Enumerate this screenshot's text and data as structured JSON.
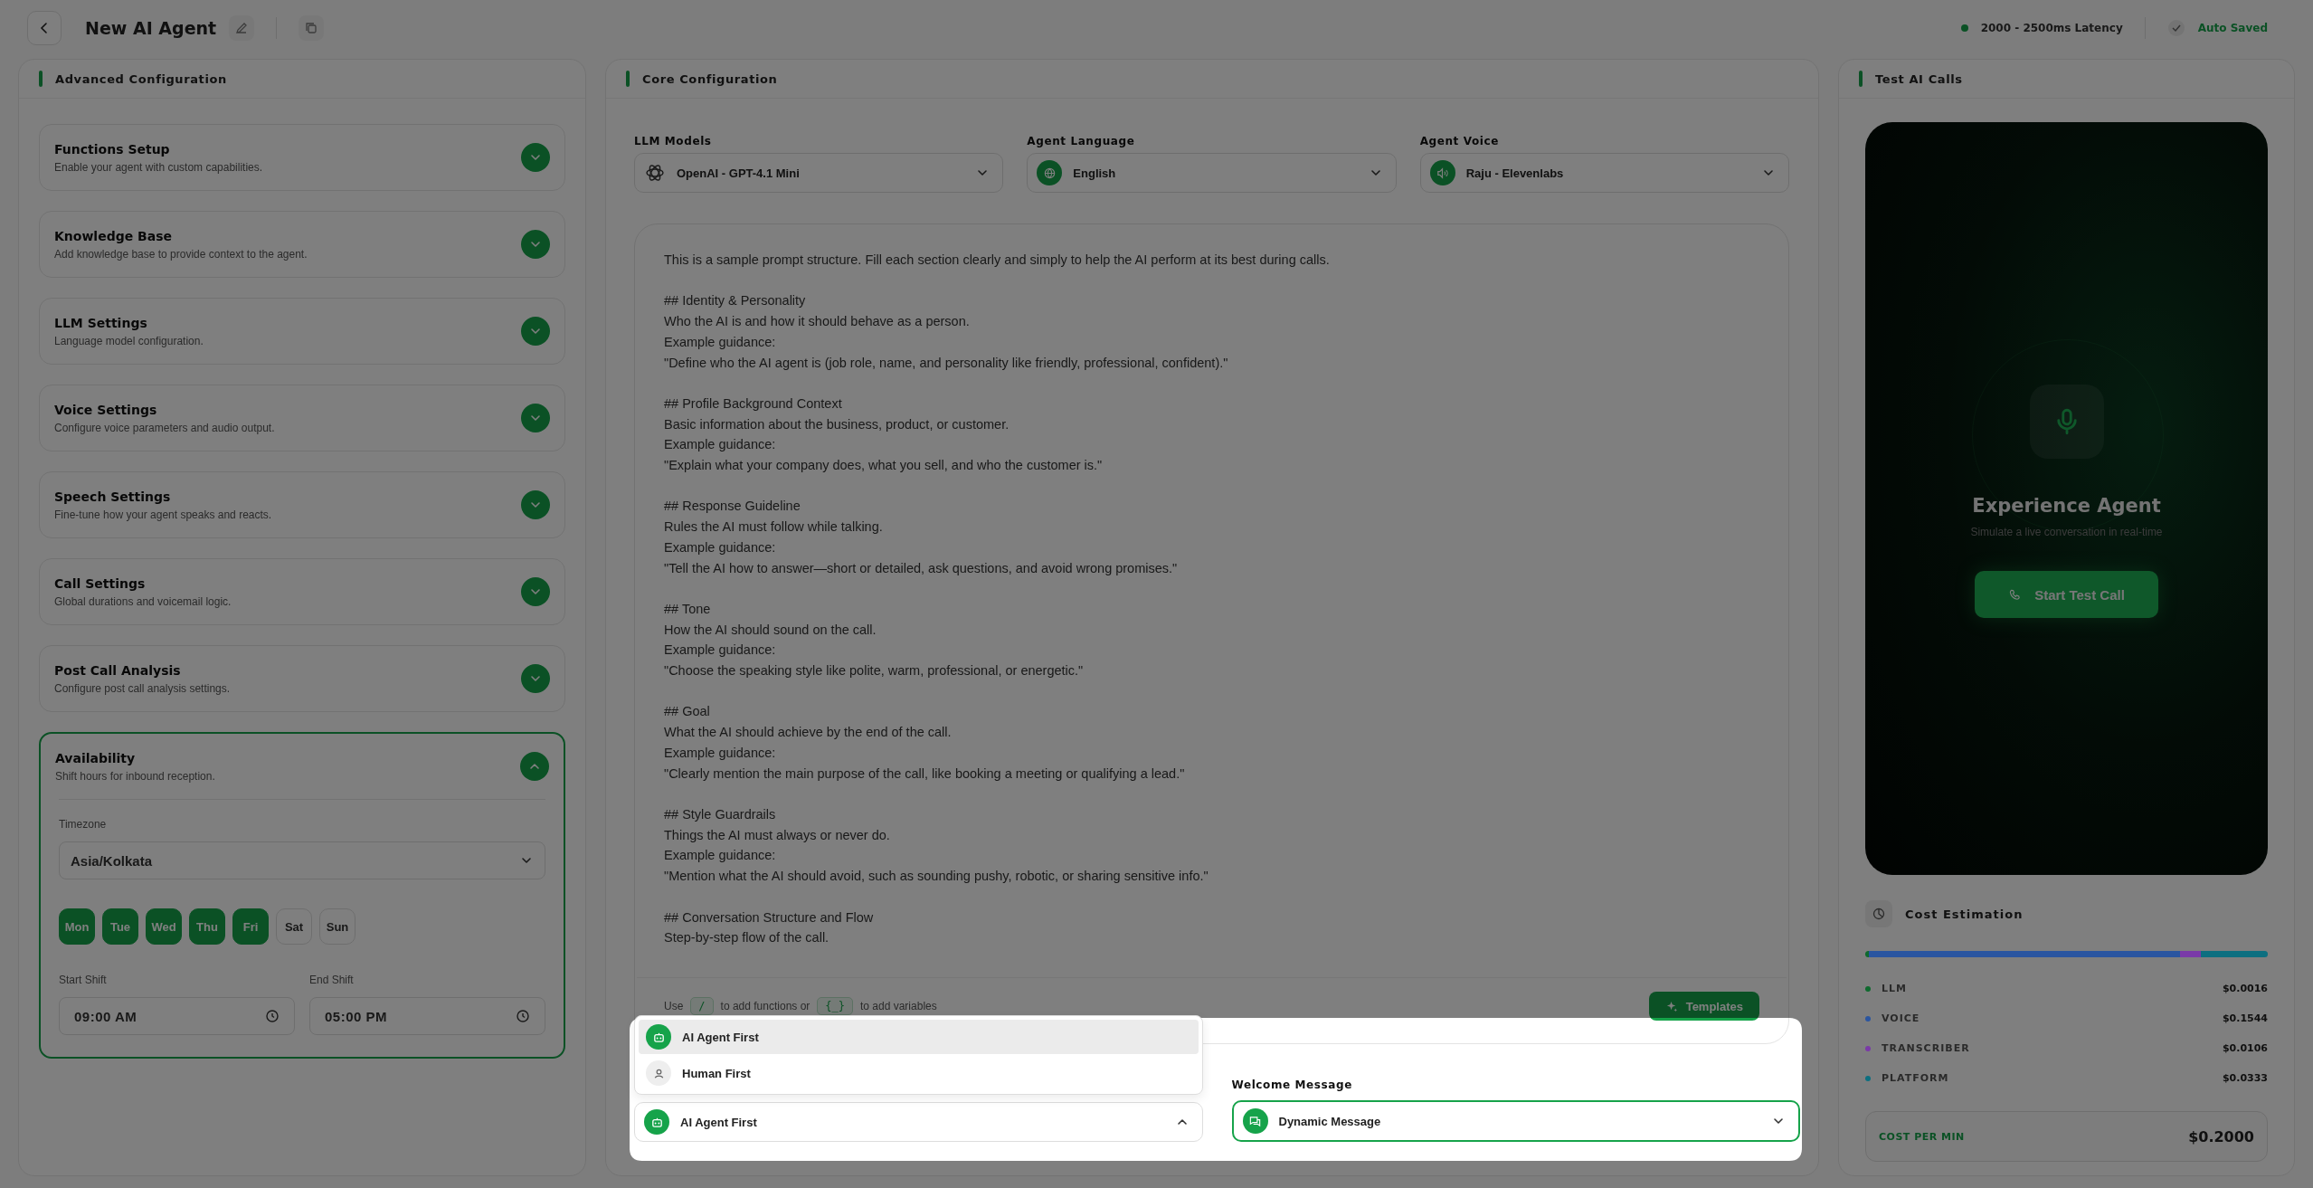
{
  "topbar": {
    "title": "New AI Agent",
    "latency": "2000 - 2500ms Latency",
    "save_status": "Auto Saved"
  },
  "advanced": {
    "title": "Advanced Configuration",
    "sections": [
      {
        "title": "Functions Setup",
        "subtitle": "Enable your agent with custom capabilities.",
        "expanded": false
      },
      {
        "title": "Knowledge Base",
        "subtitle": "Add knowledge base to provide context to the agent.",
        "expanded": false
      },
      {
        "title": "LLM Settings",
        "subtitle": "Language model configuration.",
        "expanded": false
      },
      {
        "title": "Voice Settings",
        "subtitle": "Configure voice parameters and audio output.",
        "expanded": false
      },
      {
        "title": "Speech Settings",
        "subtitle": "Fine-tune how your agent speaks and reacts.",
        "expanded": false
      },
      {
        "title": "Call Settings",
        "subtitle": "Global durations and voicemail logic.",
        "expanded": false
      },
      {
        "title": "Post Call Analysis",
        "subtitle": "Configure post call analysis settings.",
        "expanded": false
      },
      {
        "title": "Availability",
        "subtitle": "Shift hours for inbound reception.",
        "expanded": true
      }
    ],
    "availability": {
      "timezone_label": "Timezone",
      "timezone": "Asia/Kolkata",
      "days": [
        {
          "label": "Mon",
          "selected": true
        },
        {
          "label": "Tue",
          "selected": true
        },
        {
          "label": "Wed",
          "selected": true
        },
        {
          "label": "Thu",
          "selected": true
        },
        {
          "label": "Fri",
          "selected": true
        },
        {
          "label": "Sat",
          "selected": false
        },
        {
          "label": "Sun",
          "selected": false
        }
      ],
      "start_label": "Start Shift",
      "start": "09:00 AM",
      "end_label": "End Shift",
      "end": "05:00 PM"
    }
  },
  "core": {
    "title": "Core Configuration",
    "selectors": [
      {
        "label": "LLM Models",
        "value": "OpenAI - GPT-4.1 Mini",
        "kind": "model"
      },
      {
        "label": "Agent Language",
        "value": "English",
        "kind": "language"
      },
      {
        "label": "Agent Voice",
        "value": "Raju - Elevenlabs",
        "kind": "voice"
      }
    ],
    "prompt": "This is a sample prompt structure. Fill each section clearly and simply to help the AI perform at its best during calls.\n\n## Identity & Personality\nWho the AI is and how it should behave as a person.\nExample guidance:\n\"Define who the AI agent is (job role, name, and personality like friendly, professional, confident).\"\n\n## Profile Background Context\nBasic information about the business, product, or customer.\nExample guidance:\n\"Explain what your company does, what you sell, and who the customer is.\"\n\n## Response Guideline\nRules the AI must follow while talking.\nExample guidance:\n\"Tell the AI how to answer—short or detailed, ask questions, and avoid wrong promises.\"\n\n## Tone\nHow the AI should sound on the call.\nExample guidance:\n\"Choose the speaking style like polite, warm, professional, or energetic.\"\n\n## Goal\nWhat the AI should achieve by the end of the call.\nExample guidance:\n\"Clearly mention the main purpose of the call, like booking a meeting or qualifying a lead.\"\n\n## Style Guardrails\nThings the AI must always or never do.\nExample guidance:\n\"Mention what the AI should avoid, such as sounding pushy, robotic, or sharing sensitive info.\"\n\n## Conversation Structure and Flow\nStep-by-step flow of the call.",
    "hint": {
      "use": "Use",
      "slash_key": "/",
      "functions": "to add functions or",
      "var_key": "{_}",
      "variables": "to add variables"
    },
    "templates_button": "Templates",
    "first_speaker": {
      "value": "AI Agent First",
      "expanded": true,
      "focused": false,
      "options": [
        {
          "label": "AI Agent First",
          "kind": "agent",
          "selected": true
        },
        {
          "label": "Human First",
          "kind": "human",
          "selected": false
        }
      ]
    },
    "welcome": {
      "label": "Welcome Message",
      "value": "Dynamic Message",
      "expanded": false,
      "focused": true
    }
  },
  "test": {
    "title": "Test AI Calls",
    "heading": "Experience Agent",
    "subtitle": "Simulate a live conversation in real-time",
    "button": "Start Test Call",
    "cost": {
      "title": "Cost Estimation",
      "items": [
        {
          "name": "LLM",
          "value": "$0.0016",
          "color": "#0e6a2e"
        },
        {
          "name": "VOICE",
          "value": "$0.1544",
          "color": "#2a55a0"
        },
        {
          "name": "TRANSCRIBER",
          "value": "$0.0106",
          "color": "#7a3aa8"
        },
        {
          "name": "PLATFORM",
          "value": "$0.0333",
          "color": "#0d6f80"
        }
      ],
      "total_label": "COST PER MIN",
      "total": "$0.2000"
    }
  }
}
